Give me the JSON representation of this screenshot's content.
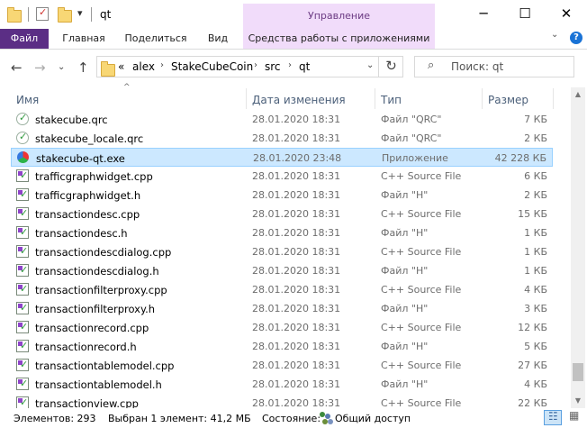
{
  "window": {
    "title": "qt",
    "context_tab_header": "Управление",
    "minimize_glyph": "─",
    "maximize_glyph": "☐",
    "close_glyph": "✕",
    "qa_dropdown_glyph": "▾"
  },
  "ribbon": {
    "tabs": [
      "Файл",
      "Главная",
      "Поделиться",
      "Вид"
    ],
    "context_tab": "Средства работы с приложениями",
    "collapse_glyph": "⌄",
    "help_glyph": "?"
  },
  "nav": {
    "back_glyph": "←",
    "forward_glyph": "→",
    "recent_glyph": "⌄",
    "up_glyph": "↑",
    "overflow": "«",
    "breadcrumb": [
      "alex",
      "StakeCubeCoin",
      "src",
      "qt"
    ],
    "crumb_separator": "›",
    "dropdown_glyph": "⌄",
    "refresh_glyph": "↻",
    "search_glyph": "⌕",
    "search_placeholder": "Поиск: qt"
  },
  "columns": {
    "name": "Имя",
    "date": "Дата изменения",
    "type": "Тип",
    "size": "Размер",
    "sort_glyph": "^"
  },
  "files": [
    {
      "name": "stakecube.qrc",
      "date": "28.01.2020 18:31",
      "type": "Файл \"QRC\"",
      "size": "7 КБ",
      "icon": "qrc"
    },
    {
      "name": "stakecube_locale.qrc",
      "date": "28.01.2020 18:31",
      "type": "Файл \"QRC\"",
      "size": "2 КБ",
      "icon": "qrc"
    },
    {
      "name": "stakecube-qt.exe",
      "date": "28.01.2020 23:48",
      "type": "Приложение",
      "size": "42 228 КБ",
      "icon": "exe",
      "selected": true
    },
    {
      "name": "trafficgraphwidget.cpp",
      "date": "28.01.2020 18:31",
      "type": "C++ Source File",
      "size": "6 КБ",
      "icon": "src"
    },
    {
      "name": "trafficgraphwidget.h",
      "date": "28.01.2020 18:31",
      "type": "Файл \"H\"",
      "size": "2 КБ",
      "icon": "src"
    },
    {
      "name": "transactiondesc.cpp",
      "date": "28.01.2020 18:31",
      "type": "C++ Source File",
      "size": "15 КБ",
      "icon": "src"
    },
    {
      "name": "transactiondesc.h",
      "date": "28.01.2020 18:31",
      "type": "Файл \"H\"",
      "size": "1 КБ",
      "icon": "src"
    },
    {
      "name": "transactiondescdialog.cpp",
      "date": "28.01.2020 18:31",
      "type": "C++ Source File",
      "size": "1 КБ",
      "icon": "src"
    },
    {
      "name": "transactiondescdialog.h",
      "date": "28.01.2020 18:31",
      "type": "Файл \"H\"",
      "size": "1 КБ",
      "icon": "src"
    },
    {
      "name": "transactionfilterproxy.cpp",
      "date": "28.01.2020 18:31",
      "type": "C++ Source File",
      "size": "4 КБ",
      "icon": "src"
    },
    {
      "name": "transactionfilterproxy.h",
      "date": "28.01.2020 18:31",
      "type": "Файл \"H\"",
      "size": "3 КБ",
      "icon": "src"
    },
    {
      "name": "transactionrecord.cpp",
      "date": "28.01.2020 18:31",
      "type": "C++ Source File",
      "size": "12 КБ",
      "icon": "src"
    },
    {
      "name": "transactionrecord.h",
      "date": "28.01.2020 18:31",
      "type": "Файл \"H\"",
      "size": "5 КБ",
      "icon": "src"
    },
    {
      "name": "transactiontablemodel.cpp",
      "date": "28.01.2020 18:31",
      "type": "C++ Source File",
      "size": "27 КБ",
      "icon": "src"
    },
    {
      "name": "transactiontablemodel.h",
      "date": "28.01.2020 18:31",
      "type": "Файл \"H\"",
      "size": "4 КБ",
      "icon": "src"
    },
    {
      "name": "transactionview.cpp",
      "date": "28.01.2020 18:31",
      "type": "C++ Source File",
      "size": "22 КБ",
      "icon": "src"
    }
  ],
  "scrollbar": {
    "up_glyph": "▲",
    "down_glyph": "▼"
  },
  "status": {
    "count": "Элементов: 293",
    "selected": "Выбран 1 элемент: 41,2 МБ",
    "state_label": "Состояние:",
    "share": "Общий доступ"
  },
  "colors": {
    "file_tab": "#5b2e85",
    "context_tab": "#f1dcfa",
    "selection": "#cce8ff",
    "header_text": "#4c607a"
  }
}
